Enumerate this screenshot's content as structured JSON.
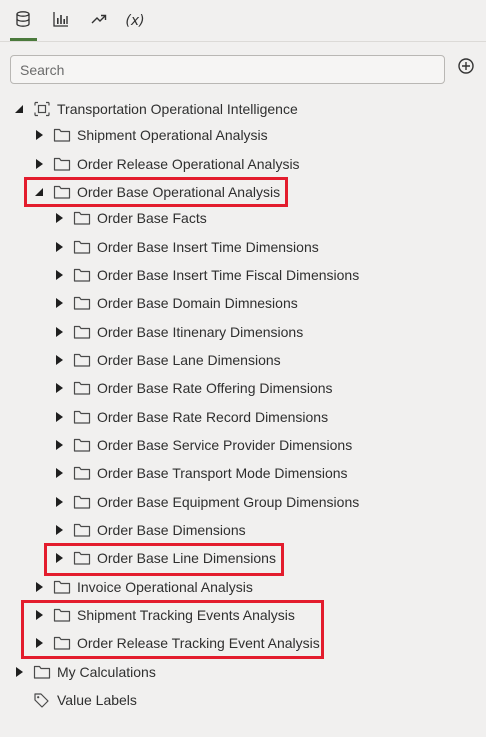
{
  "tabs": [
    {
      "name": "data-icon",
      "active": true
    },
    {
      "name": "chart-icon",
      "active": false
    },
    {
      "name": "trend-icon",
      "active": false
    },
    {
      "name": "function-icon",
      "label": "(x)",
      "active": false
    }
  ],
  "search": {
    "placeholder": "Search",
    "value": ""
  },
  "tree": {
    "root": {
      "label": "Transportation Operational Intelligence",
      "expanded": true
    },
    "items": [
      {
        "label": "Shipment Operational Analysis",
        "expanded": false
      },
      {
        "label": "Order Release Operational Analysis",
        "expanded": false
      },
      {
        "label": "Order Base Operational Analysis",
        "expanded": true,
        "highlighted": true
      },
      {
        "label": "Order Base Facts",
        "expanded": false
      },
      {
        "label": "Order Base Insert Time Dimensions",
        "expanded": false
      },
      {
        "label": "Order Base Insert Time Fiscal Dimensions",
        "expanded": false
      },
      {
        "label": "Order Base Domain Dimnesions",
        "expanded": false
      },
      {
        "label": "Order Base Itinenary Dimensions",
        "expanded": false
      },
      {
        "label": "Order Base Lane Dimensions",
        "expanded": false
      },
      {
        "label": "Order Base Rate Offering Dimensions",
        "expanded": false
      },
      {
        "label": "Order Base Rate Record Dimensions",
        "expanded": false
      },
      {
        "label": "Order Base Service Provider Dimensions",
        "expanded": false
      },
      {
        "label": "Order Base Transport Mode Dimensions",
        "expanded": false
      },
      {
        "label": "Order Base Equipment Group Dimensions",
        "expanded": false
      },
      {
        "label": "Order Base Dimensions",
        "expanded": false
      },
      {
        "label": "Order Base Line Dimensions",
        "expanded": false,
        "highlighted": true
      },
      {
        "label": "Invoice Operational Analysis",
        "expanded": false
      },
      {
        "label": "Shipment Tracking Events Analysis",
        "expanded": false,
        "highlighted": true
      },
      {
        "label": "Order Release Tracking Event Analysis",
        "expanded": false,
        "highlighted": true
      }
    ],
    "my_calculations": {
      "label": "My Calculations",
      "expanded": false
    },
    "value_labels": {
      "label": "Value Labels"
    }
  },
  "colors": {
    "accent": "#4b7a3c",
    "highlight": "#e31c2d",
    "background": "#f1f0ef"
  }
}
